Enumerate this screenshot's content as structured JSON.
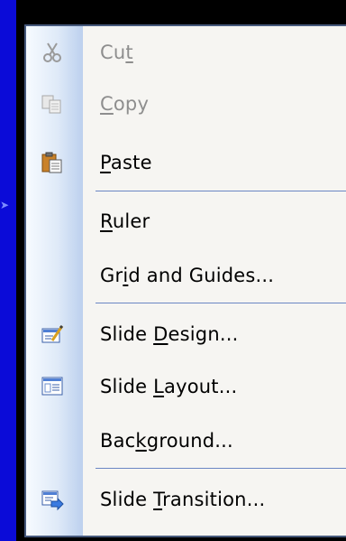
{
  "menu": {
    "items": [
      {
        "id": "cut",
        "pre": "Cu",
        "key": "t",
        "post": "",
        "icon": "scissors-icon",
        "disabled": true
      },
      {
        "id": "copy",
        "pre": "",
        "key": "C",
        "post": "opy",
        "icon": "copy-icon",
        "disabled": true
      },
      {
        "id": "paste",
        "pre": "",
        "key": "P",
        "post": "aste",
        "icon": "clipboard-paste-icon",
        "disabled": false
      },
      {
        "id": "ruler",
        "pre": "",
        "key": "R",
        "post": "uler",
        "icon": "",
        "disabled": false
      },
      {
        "id": "grid",
        "pre": "Gr",
        "key": "i",
        "post": "d and Guides...",
        "icon": "",
        "disabled": false
      },
      {
        "id": "slide-design",
        "pre": "Slide ",
        "key": "D",
        "post": "esign...",
        "icon": "slide-design-icon",
        "disabled": false
      },
      {
        "id": "slide-layout",
        "pre": "Slide ",
        "key": "L",
        "post": "ayout...",
        "icon": "slide-layout-icon",
        "disabled": false
      },
      {
        "id": "background",
        "pre": "Bac",
        "key": "k",
        "post": "ground...",
        "icon": "",
        "disabled": false
      },
      {
        "id": "slide-transition",
        "pre": "Slide ",
        "key": "T",
        "post": "ransition...",
        "icon": "slide-transition-icon",
        "disabled": false
      }
    ]
  },
  "colors": {
    "menu_border": "#46597c",
    "separator": "#6b86c4",
    "disabled_text": "#8e8e8e"
  }
}
